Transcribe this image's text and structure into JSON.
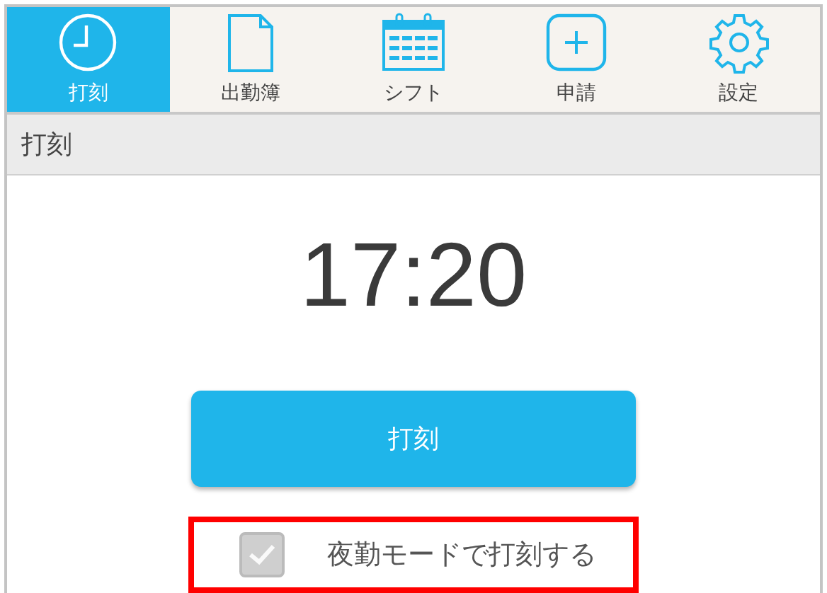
{
  "tabs": [
    {
      "label": "打刻",
      "selected": true
    },
    {
      "label": "出勤簿",
      "selected": false
    },
    {
      "label": "シフト",
      "selected": false
    },
    {
      "label": "申請",
      "selected": false
    },
    {
      "label": "設定",
      "selected": false
    }
  ],
  "page_title": "打刻",
  "time": "17:20",
  "punch_button": "打刻",
  "night_mode": {
    "label": "夜勤モードで打刻する",
    "checked": true,
    "disabled": true,
    "highlighted": true
  }
}
